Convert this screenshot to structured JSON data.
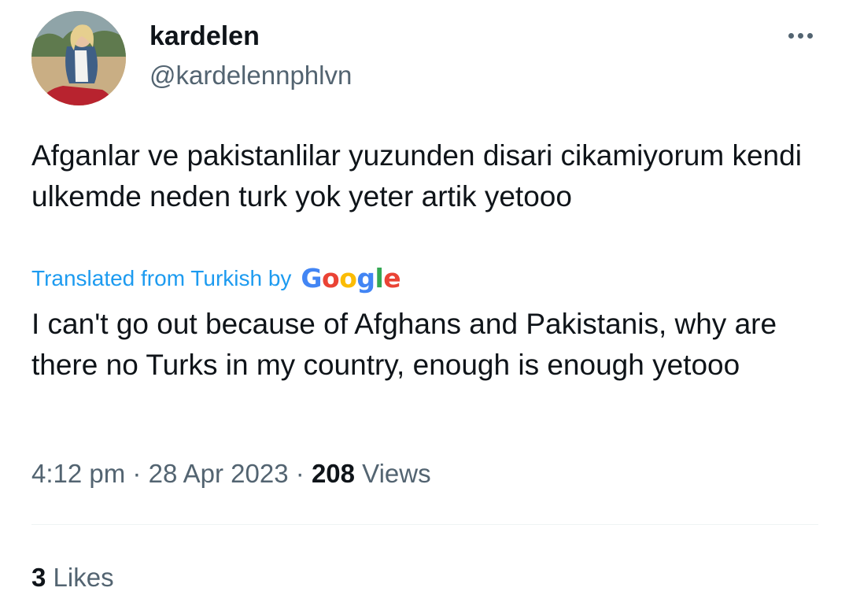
{
  "author": {
    "display_name": "kardelen",
    "handle": "@kardelennphlvn"
  },
  "tweet": {
    "original_text": "Afganlar ve pakistanlilar yuzunden disari cikamiyorum kendi ulkemde neden turk yok yeter artik yetooo",
    "translated_label": "Translated from Turkish by",
    "translation_provider": "Google",
    "translated_text": "I can't go out because of Afghans and Pakistanis, why are there no Turks in my country, enough is enough yetooo",
    "time": "4:12 pm",
    "date": "28 Apr 2023",
    "separator": "·",
    "views_count": "208",
    "views_label": "Views",
    "likes_count": "3",
    "likes_label": "Likes"
  },
  "icons": {
    "more": "more-horizontal-icon"
  },
  "colors": {
    "text_primary": "#0f1419",
    "text_secondary": "#536471",
    "link": "#1d9bf0",
    "divider": "#eff3f4"
  }
}
